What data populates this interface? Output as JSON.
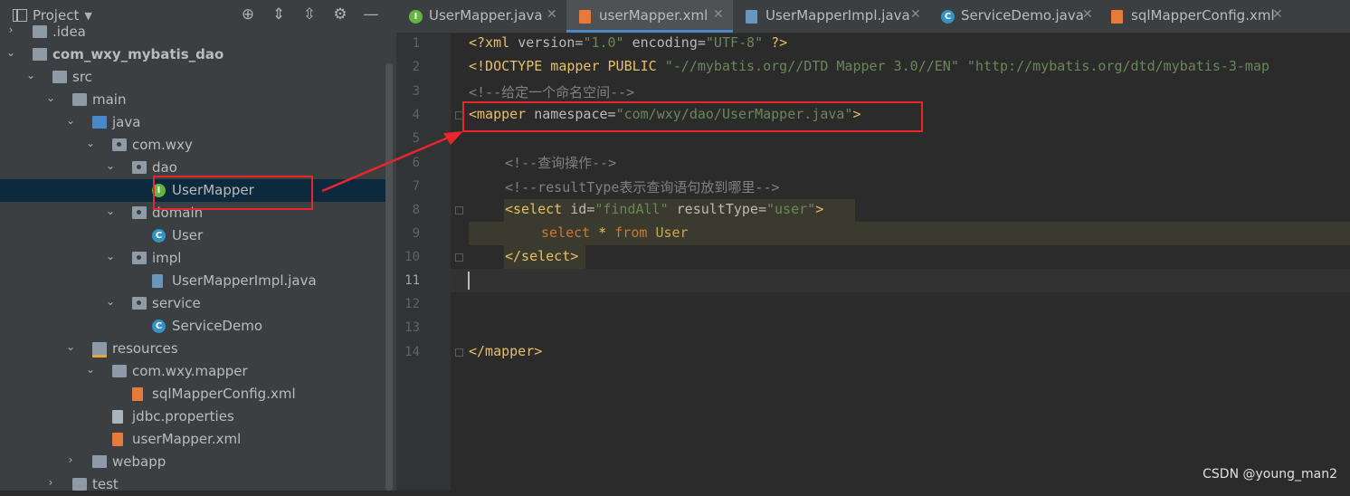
{
  "project_panel": {
    "title": "Project",
    "tree": [
      {
        "label": ".idea",
        "indent": 1,
        "arrow": "right",
        "icon": "folder-icon"
      },
      {
        "label": "com_wxy_mybatis_dao",
        "indent": 1,
        "arrow": "down",
        "icon": "module-folder-icon",
        "bold": true
      },
      {
        "label": "src",
        "indent": 2,
        "arrow": "down",
        "icon": "folder-icon"
      },
      {
        "label": "main",
        "indent": 3,
        "arrow": "down",
        "icon": "folder-icon"
      },
      {
        "label": "java",
        "indent": 4,
        "arrow": "down",
        "icon": "source-folder-icon"
      },
      {
        "label": "com.wxy",
        "indent": 5,
        "arrow": "down",
        "icon": "package-icon"
      },
      {
        "label": "dao",
        "indent": 6,
        "arrow": "down",
        "icon": "package-icon"
      },
      {
        "label": "UserMapper",
        "indent": 7,
        "arrow": "",
        "icon": "interface-icon",
        "selected": true
      },
      {
        "label": "domain",
        "indent": 6,
        "arrow": "down",
        "icon": "package-icon"
      },
      {
        "label": "User",
        "indent": 7,
        "arrow": "",
        "icon": "class-icon"
      },
      {
        "label": "impl",
        "indent": 6,
        "arrow": "down",
        "icon": "package-icon"
      },
      {
        "label": "UserMapperImpl.java",
        "indent": 7,
        "arrow": "",
        "icon": "java-file-icon"
      },
      {
        "label": "service",
        "indent": 6,
        "arrow": "down",
        "icon": "package-icon"
      },
      {
        "label": "ServiceDemo",
        "indent": 7,
        "arrow": "",
        "icon": "class-icon"
      },
      {
        "label": "resources",
        "indent": 4,
        "arrow": "down",
        "icon": "resources-folder-icon"
      },
      {
        "label": "com.wxy.mapper",
        "indent": 5,
        "arrow": "down",
        "icon": "folder-icon"
      },
      {
        "label": "sqlMapperConfig.xml",
        "indent": 6,
        "arrow": "",
        "icon": "xml-file-icon"
      },
      {
        "label": "jdbc.properties",
        "indent": 5,
        "arrow": "",
        "icon": "properties-file-icon"
      },
      {
        "label": "userMapper.xml",
        "indent": 5,
        "arrow": "",
        "icon": "xml-file-icon"
      },
      {
        "label": "webapp",
        "indent": 4,
        "arrow": "right",
        "icon": "folder-icon"
      },
      {
        "label": "test",
        "indent": 3,
        "arrow": "right",
        "icon": "folder-icon"
      }
    ]
  },
  "tabs": [
    {
      "label": "UserMapper.java",
      "icon": "interface-icon",
      "active": false
    },
    {
      "label": "userMapper.xml",
      "icon": "xml-file-icon",
      "active": true
    },
    {
      "label": "UserMapperImpl.java",
      "icon": "java-file-icon",
      "active": false
    },
    {
      "label": "ServiceDemo.java",
      "icon": "class-icon",
      "active": false
    },
    {
      "label": "sqlMapperConfig.xml",
      "icon": "xml-file-icon",
      "active": false
    }
  ],
  "editor": {
    "line_numbers": [
      "1",
      "2",
      "3",
      "4",
      "5",
      "6",
      "7",
      "8",
      "9",
      "10",
      "11",
      "12",
      "13",
      "14"
    ],
    "current_line": "11",
    "lines": {
      "l1": [
        "<?xml ",
        "version",
        "=",
        "\"1.0\"",
        " encoding",
        "=",
        "\"UTF-8\"",
        " ?>"
      ],
      "l2a": "<!DOCTYPE mapper PUBLIC ",
      "l2b": "\"-//mybatis.org//DTD Mapper 3.0//EN\"",
      "l2c": " ",
      "l2d": "\"http://mybatis.org/dtd/mybatis-3-map",
      "l3": "<!--给定一个命名空间-->",
      "l4": [
        "<mapper",
        " namespace",
        "=",
        "\"com/wxy/dao/UserMapper.java\"",
        ">"
      ],
      "l6": "<!--查询操作-->",
      "l7": "<!--resultType表示查询语句放到哪里-->",
      "l8": [
        "<select",
        " id",
        "=",
        "\"findAll\"",
        " resultType",
        "=",
        "\"user\"",
        ">"
      ],
      "l9": [
        "select ",
        "* ",
        "from ",
        "User"
      ],
      "l10": "</select>",
      "l14": "</mapper>"
    }
  },
  "watermark": "CSDN @young_man2",
  "colors": {
    "highlight_box": "#e8262b",
    "selection": "#0d293e"
  }
}
